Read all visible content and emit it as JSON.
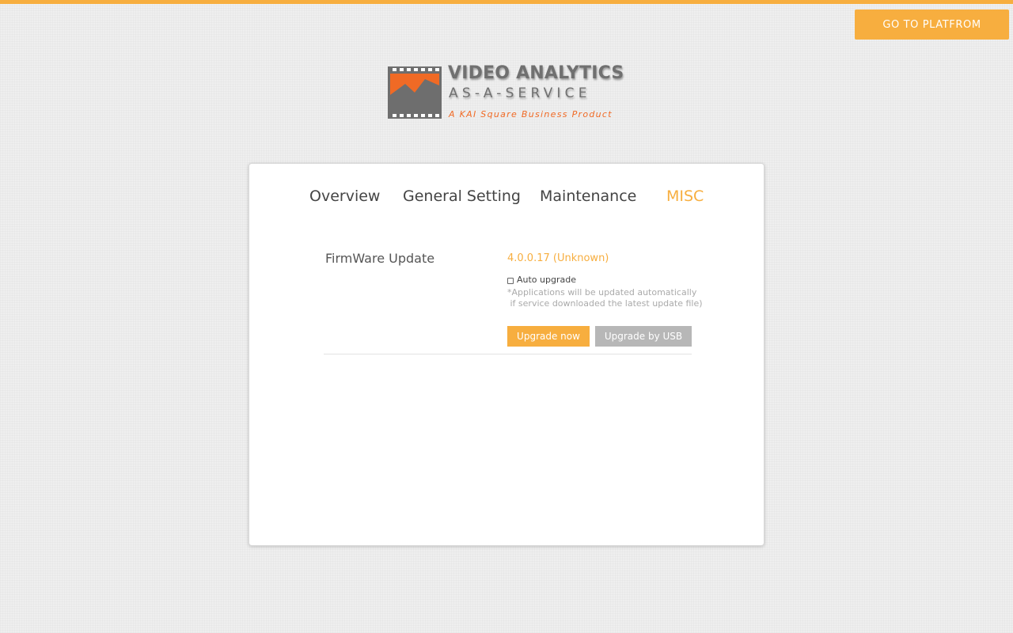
{
  "header": {
    "accent_color": "#f7ae3f",
    "platform_button_label": "GO TO PLATFROM"
  },
  "logo": {
    "line1": "VIDEO ANALYTICS",
    "line2": "AS-A-SERVICE",
    "tagline": "A KAI Square Business Product",
    "icon": "film-chart-icon"
  },
  "tabs": [
    {
      "label": "Overview",
      "active": false
    },
    {
      "label": "General Setting",
      "active": false
    },
    {
      "label": "Maintenance",
      "active": false
    },
    {
      "label": "MISC",
      "active": true
    }
  ],
  "firmware": {
    "label": "FirmWare Update",
    "version": "4.0.0.17 (Unknown)",
    "auto_upgrade_label": "Auto upgrade",
    "auto_upgrade_checked": false,
    "note": "*Applications will be updated automatically\n if service downloaded the latest update file)",
    "upgrade_now_label": "Upgrade now",
    "upgrade_usb_label": "Upgrade by USB"
  },
  "colors": {
    "accent": "#f7ae3f",
    "logo_orange": "#f06a25",
    "secondary_button": "#b7b7b7"
  }
}
